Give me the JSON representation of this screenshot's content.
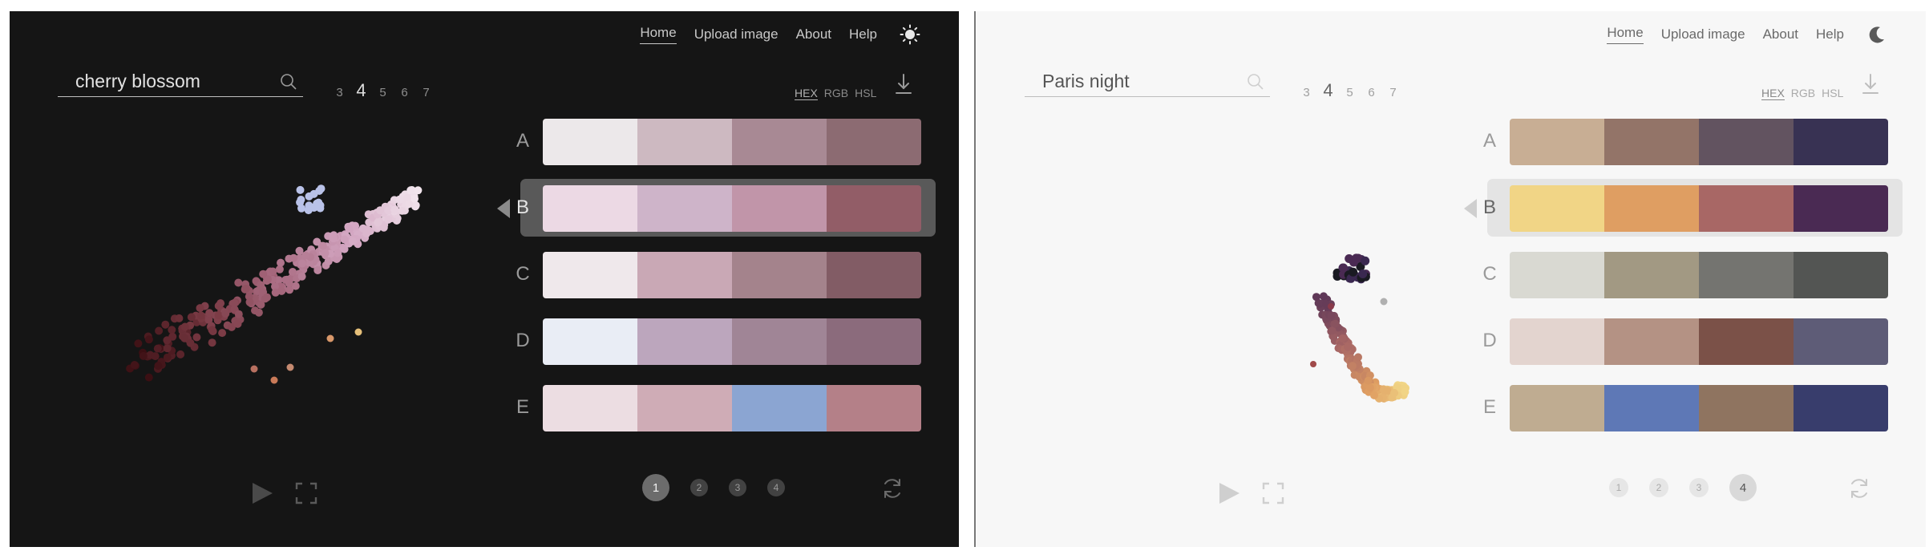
{
  "nav": {
    "home": "Home",
    "upload": "Upload image",
    "about": "About",
    "help": "Help"
  },
  "formats": {
    "hex": "HEX",
    "rgb": "RGB",
    "hsl": "HSL",
    "active": "HEX"
  },
  "counts": [
    "3",
    "4",
    "5",
    "6",
    "7"
  ],
  "left": {
    "theme": "dark",
    "theme_toggle_icon": "sun-icon",
    "search_value": "cherry blossom",
    "active_count": "4",
    "selected_row": "B",
    "active_page": "1",
    "pages": [
      "1",
      "2",
      "3",
      "4"
    ],
    "palettes": [
      {
        "label": "A",
        "colors": [
          "#ece8ea",
          "#cdb9c1",
          "#a88994",
          "#8c6b72"
        ]
      },
      {
        "label": "B",
        "colors": [
          "#ecd9e4",
          "#ceb4c9",
          "#c195a9",
          "#925d67"
        ]
      },
      {
        "label": "C",
        "colors": [
          "#efe8eb",
          "#c9a8b5",
          "#a4838c",
          "#825c65"
        ]
      },
      {
        "label": "D",
        "colors": [
          "#e9edf5",
          "#bca6bd",
          "#a08596",
          "#8b6b7c"
        ]
      },
      {
        "label": "E",
        "colors": [
          "#ecdde2",
          "#cfacb6",
          "#8ba5d2",
          "#b48088"
        ]
      }
    ]
  },
  "right": {
    "theme": "light",
    "theme_toggle_icon": "moon-icon",
    "search_value": "Paris night",
    "active_count": "4",
    "selected_row": "B",
    "active_page": "4",
    "pages": [
      "1",
      "2",
      "3",
      "4"
    ],
    "palettes": [
      {
        "label": "A",
        "colors": [
          "#c8ae94",
          "#937468",
          "#625360",
          "#383253"
        ]
      },
      {
        "label": "B",
        "colors": [
          "#f1d586",
          "#df9e62",
          "#a86765",
          "#4a2a53"
        ]
      },
      {
        "label": "C",
        "colors": [
          "#d9d9d2",
          "#a29983",
          "#747470",
          "#535553"
        ]
      },
      {
        "label": "D",
        "colors": [
          "#e3d4cf",
          "#b49284",
          "#7b5148",
          "#5e5c77"
        ]
      },
      {
        "label": "E",
        "colors": [
          "#bfac91",
          "#5e78b6",
          "#8f7460",
          "#383d6c"
        ]
      }
    ]
  }
}
